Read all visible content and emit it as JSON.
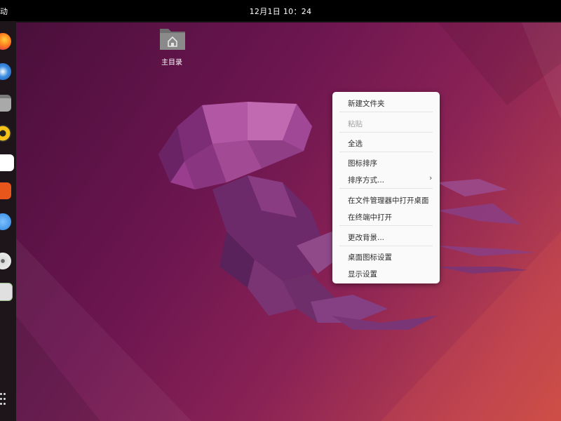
{
  "topbar": {
    "activities_label": "动",
    "clock": "12月1日  10：24"
  },
  "desktop": {
    "home_label": "主目录"
  },
  "dock": {
    "items": [
      "firefox-icon",
      "thunderbird-icon",
      "files-icon",
      "rhythmbox-icon",
      "libreoffice-writer-icon",
      "app-center-icon",
      "help-icon",
      "disc-icon",
      "trash-icon"
    ],
    "show_apps_icon": "app-grid-icon"
  },
  "context_menu": {
    "new_folder": "新建文件夹",
    "paste": "粘贴",
    "select_all": "全选",
    "arrange_icons": "图标排序",
    "sort_by": "排序方式...",
    "open_in_files": "在文件管理器中打开桌面",
    "open_in_terminal": "在终端中打开",
    "change_background": "更改背景...",
    "desktop_icon_settings": "桌面图标设置",
    "display_settings": "显示设置"
  },
  "colors": {
    "wallpaper_start": "#4a0f3b",
    "wallpaper_end": "#c84b45",
    "jellyfish": "#8e3a85",
    "menu_bg": "#fafafa",
    "topbar_bg": "#000000"
  }
}
